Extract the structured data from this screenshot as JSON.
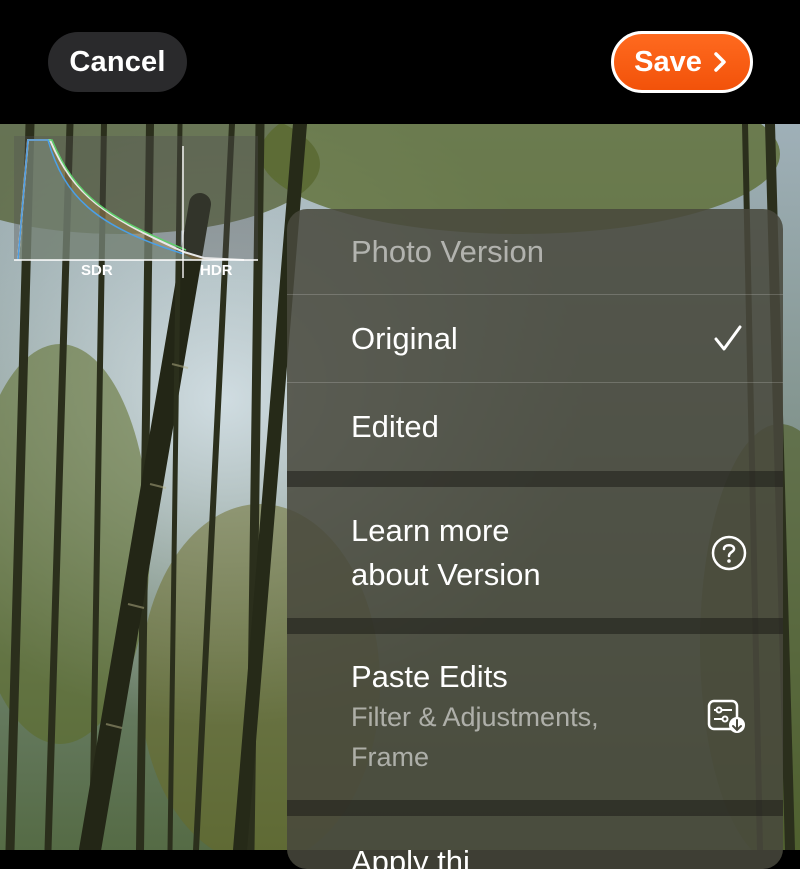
{
  "toolbar": {
    "cancel_label": "Cancel",
    "save_label": "Save"
  },
  "histogram": {
    "sdr_label": "SDR",
    "hdr_label": "HDR"
  },
  "menu": {
    "header": "Photo Version",
    "items": [
      {
        "label": "Original",
        "selected": true,
        "icon": "checkmark-icon"
      },
      {
        "label": "Edited",
        "selected": false
      },
      {
        "label_line1": "Learn more",
        "label_line2": "about Version",
        "icon": "help-circle-icon"
      },
      {
        "label": "Paste Edits",
        "subtitle_line1": "Filter & Adjustments,",
        "subtitle_line2": "Frame",
        "icon": "paste-edits-icon"
      },
      {
        "label": "Apply thi",
        "partial": true
      }
    ]
  },
  "colors": {
    "save_button": "#f2520a",
    "menu_background": "#48483c",
    "topbar": "#000000"
  }
}
